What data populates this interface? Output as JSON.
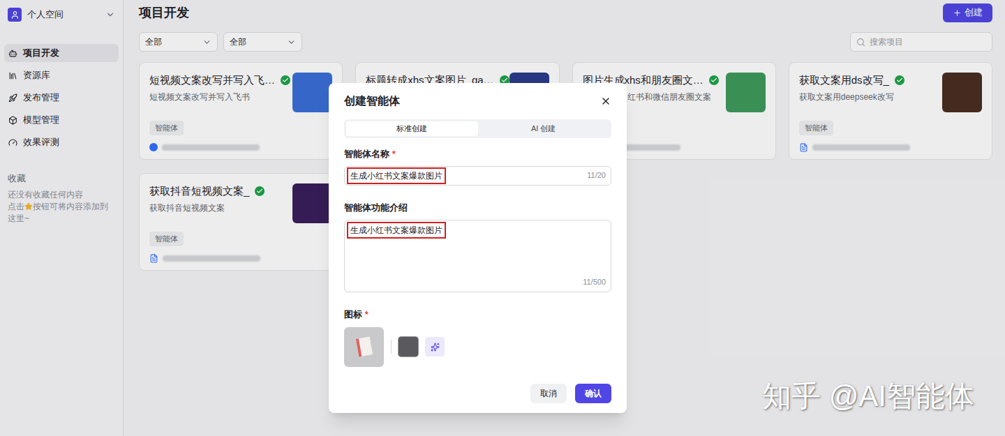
{
  "sidebar": {
    "workspace": "个人空间",
    "items": [
      {
        "label": "项目开发",
        "selected": true
      },
      {
        "label": "资源库",
        "selected": false
      },
      {
        "label": "发布管理",
        "selected": false
      },
      {
        "label": "模型管理",
        "selected": false
      },
      {
        "label": "效果评测",
        "selected": false
      }
    ],
    "favorites": {
      "title": "收藏",
      "empty": "还没有收藏任何内容",
      "hint_before": "点击",
      "hint_after": "按钮可将内容添加到这里~"
    }
  },
  "header": {
    "title": "项目开发",
    "create_button": "创建"
  },
  "filters": [
    {
      "value": "全部"
    },
    {
      "value": "全部"
    }
  ],
  "search": {
    "placeholder": "搜索项目"
  },
  "cards": [
    {
      "title": "短视频文案改写并写入飞…",
      "description": "短视频文案改写并写入飞书",
      "tag": "智能体",
      "published": true,
      "color": "#3b6fd8",
      "clipped_left": false,
      "footer": "avatar"
    },
    {
      "title": "标题转成xhs文案图片_ga…",
      "description": "",
      "tag": "",
      "published": true,
      "color": "#2c3c8c",
      "clipped_left": false,
      "footer": "none"
    },
    {
      "title": "图片生成xhs和朋友圈文…",
      "description": "红书和微信朋友圈文案",
      "tag": "",
      "published": true,
      "color": "#3f9a5c",
      "clipped_left": true,
      "footer": "blur"
    },
    {
      "title": "获取文案用ds改写_",
      "description": "获取文案用deepseek改写",
      "tag": "智能体",
      "published": true,
      "color": "#4a2e22",
      "clipped_left": false,
      "footer": "doc"
    },
    {
      "title": "获取抖音短视频文案_",
      "description": "获取抖音短视频文案",
      "tag": "智能体",
      "published": true,
      "color": "#3a1f5c",
      "clipped_left": false,
      "footer": "doc"
    }
  ],
  "dialog": {
    "title": "创建智能体",
    "tabs": [
      {
        "label": "标准创建",
        "selected": true
      },
      {
        "label": "AI 创建",
        "selected": false
      }
    ],
    "name_label": "智能体名称",
    "name_value": "生成小红书文案爆款图片",
    "name_count": "11/20",
    "name_highlighted": true,
    "desc_label": "智能体功能介绍",
    "desc_value": "生成小红书文案爆款图片",
    "desc_count": "11/500",
    "desc_highlighted": true,
    "icon_label": "图标",
    "required_mark": "*",
    "cancel": "取消",
    "confirm": "确认"
  },
  "watermark": "知乎 @AI智能体"
}
